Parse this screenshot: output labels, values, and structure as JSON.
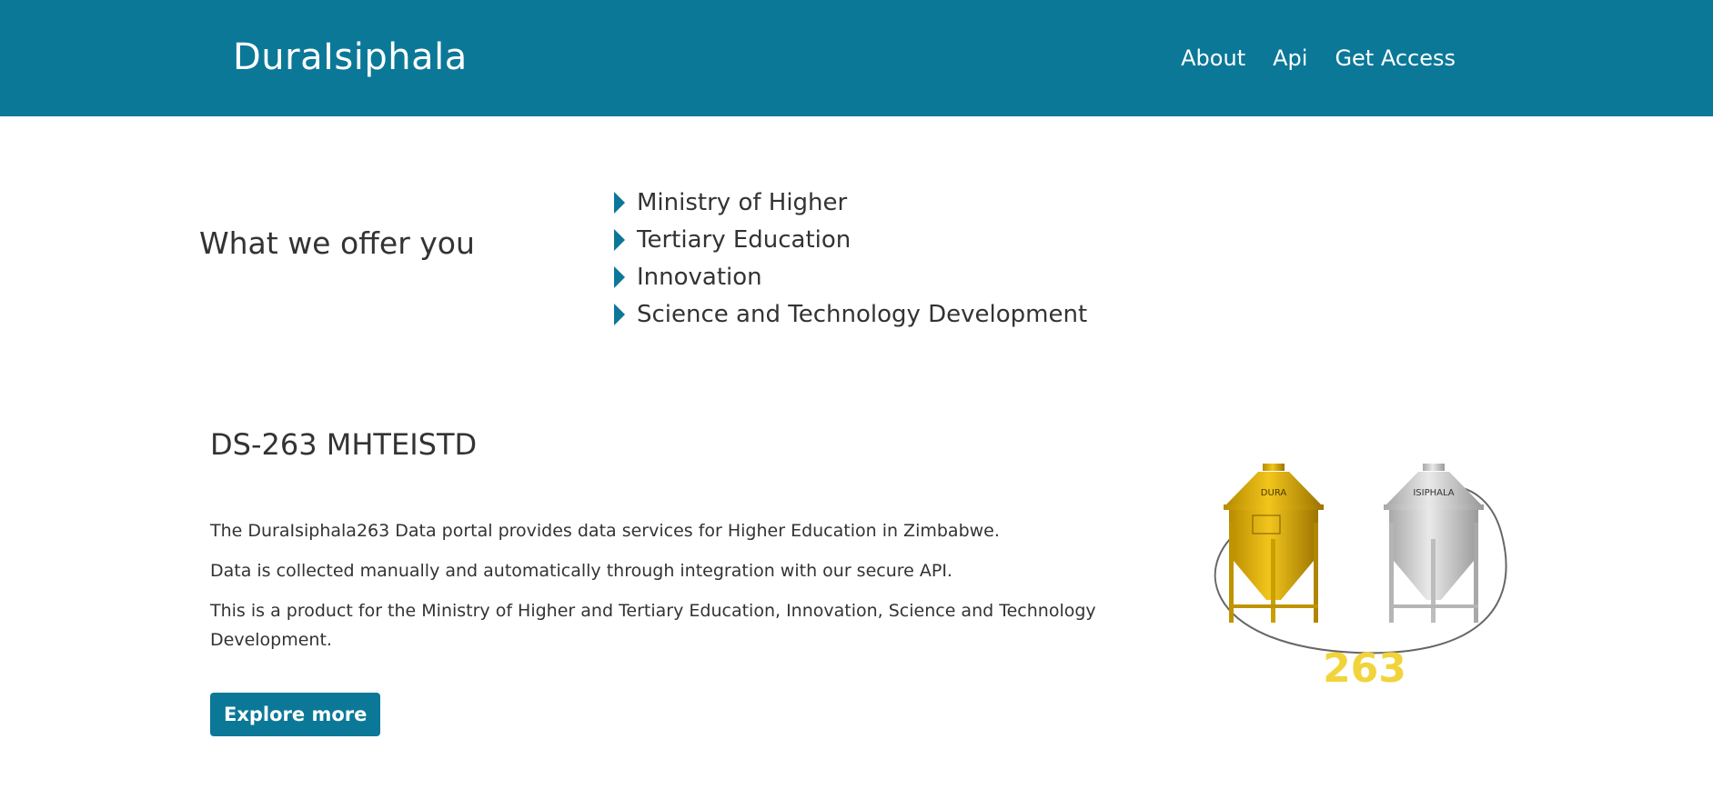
{
  "header": {
    "brand": "DuraIsiphala",
    "nav": [
      {
        "label": "About"
      },
      {
        "label": "Api"
      },
      {
        "label": "Get Access"
      }
    ]
  },
  "offer": {
    "heading": "What we offer you",
    "items": [
      "Ministry of Higher",
      "Tertiary Education",
      "Innovation",
      "Science and Technology Development"
    ]
  },
  "intro": {
    "title": "DS-263 MHTEISTD",
    "paragraphs": [
      "The DuraIsiphala263 Data portal provides data services for Higher Education in Zimbabwe.",
      "Data is collected manually and automatically through integration with our secure API.",
      "This is a product for the Ministry of Higher and Tertiary Education, Innovation, Science and Technology Development."
    ],
    "button_label": "Explore more"
  },
  "logo": {
    "left_silo_label": "DURA",
    "right_silo_label": "ISIPHALA",
    "number": "263",
    "colors": {
      "gold": "#d4a917",
      "silver": "#c8c8c8",
      "number": "#f0d43a"
    }
  },
  "colors": {
    "accent": "#0b7898",
    "text": "#333333"
  }
}
